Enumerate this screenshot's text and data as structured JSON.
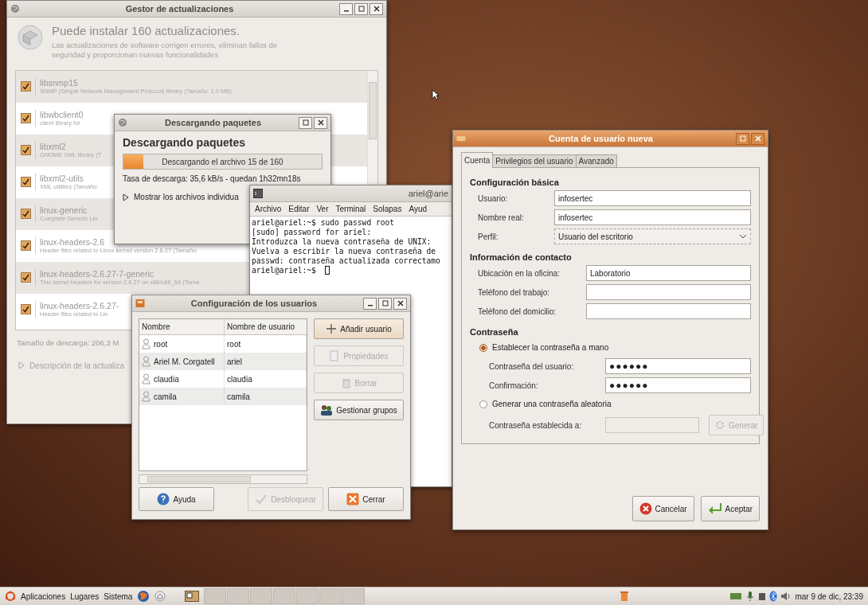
{
  "update_manager": {
    "title": "Gestor de actualizaciones",
    "heading": "Puede instalar 160 actualizaciones.",
    "description": "Las actualizaciones de software corrigen errores, eliminan fallos de seguridad y proporcionan nuevas funcionalidades",
    "packages": [
      {
        "name": "libsnmp15",
        "description": "SNMP (Simple Network Management Protocol) library (Tamaño: 1.0 MB)",
        "checked": true
      },
      {
        "name": "libwbclient0",
        "description": "client library for",
        "checked": true
      },
      {
        "name": "libxml2",
        "description": "GNOME XML library (T",
        "checked": true
      },
      {
        "name": "libxml2-utils",
        "description": "XML utilities (Tamaño:",
        "checked": true
      },
      {
        "name": "linux-generic",
        "description": "Complete Generic Lin",
        "checked": true
      },
      {
        "name": "linux-headers-2.6",
        "description": "Header files related to Linux kernel version 2.6.27 (Tamaño:",
        "checked": true
      },
      {
        "name": "linux-headers-2.6.27-7-generic",
        "description": "This kernel headers for version 2.6.27 on x86/x86_64 (Tama",
        "checked": true
      },
      {
        "name": "linux-headers-2.6.27-",
        "description": "Header files related to Lin",
        "checked": true
      }
    ],
    "download_size": "Tamaño de descarga: 206,3 M",
    "details_toggle": "Descripción de la actualiza"
  },
  "download_dialog": {
    "title": "Descargando paquetes",
    "heading": "Descargando paquetes",
    "progress": {
      "level": 0.1,
      "label": "Descargando el archivo 15 de 160"
    },
    "rate": "Tasa de descarga: 35,6 kB/s - quedan 1h32mn18s",
    "details_toggle": "Mostrar los archivos individua"
  },
  "terminal": {
    "title": "ariel@arie",
    "menu": [
      "Archivo",
      "Editar",
      "Ver",
      "Terminal",
      "Solapas",
      "Ayud"
    ],
    "lines": [
      "ariel@ariel:~$ sudo passwd root",
      "[sudo] password for ariel:",
      "Introduzca la nueva contraseña de UNIX:",
      "Vuelva a escribir la nueva contraseña de",
      "passwd: contraseña actualizada correctamo",
      "ariel@ariel:~$"
    ]
  },
  "users_dialog": {
    "title": "Configuración de los usuarios",
    "columns": [
      "Nombre",
      "Nombre de usuario"
    ],
    "users": [
      {
        "name": "root",
        "username": "root"
      },
      {
        "name": "Ariel M. Corgatell",
        "username": "ariel"
      },
      {
        "name": "claudia",
        "username": "claudia"
      },
      {
        "name": "camila",
        "username": "camila"
      }
    ],
    "side_buttons": [
      {
        "label": "Añadir usuario",
        "kind": "add",
        "disabled": false
      },
      {
        "label": "Propiedades",
        "kind": "properties",
        "disabled": true
      },
      {
        "label": "Borrar",
        "kind": "delete",
        "disabled": true
      },
      {
        "label": "Gestionar grupos",
        "kind": "groups",
        "disabled": false
      }
    ],
    "bottom_buttons": [
      {
        "label": "Ayuda",
        "kind": "help",
        "disabled": false
      },
      {
        "label": "Desbloquear",
        "kind": "unlock",
        "disabled": true
      },
      {
        "label": "Cerrar",
        "kind": "close",
        "disabled": false
      }
    ]
  },
  "account_dialog": {
    "title": "Cuenta de usuario nueva",
    "tabs": [
      {
        "label": "Cuenta",
        "selected": true
      },
      {
        "label": "Privilegios del usuario",
        "selected": false
      },
      {
        "label": "Avanzado",
        "selected": false
      }
    ],
    "basic": {
      "heading": "Configuración básica",
      "fields": [
        {
          "label": "Usuario:",
          "value": "infosertec",
          "kind": "text"
        },
        {
          "label": "Nombre real:",
          "value": "infosertec",
          "kind": "text"
        },
        {
          "label": "Perfil:",
          "value": "Usuario del escritorio",
          "kind": "select"
        }
      ]
    },
    "contact": {
      "heading": "Información de contacto",
      "fields": [
        {
          "label": "Ubicación en la oficina:",
          "value": "Laboratorio"
        },
        {
          "label": "Teléfono del trabajo:"
        },
        {
          "label": "Teléfono del domicilio:"
        }
      ]
    },
    "password": {
      "heading": "Contraseña",
      "manual": {
        "label": "Establecer la contraseña a mano",
        "selected": true
      },
      "fields": [
        {
          "label": "Contraseña del usuario:",
          "value": "●●●●●●"
        },
        {
          "label": "Confirmación:",
          "value": "●●●●●●"
        }
      ],
      "random": {
        "label": "Generar una contraseña aleatoria",
        "selected": false
      },
      "generated_label": "Contraseña establecida a:",
      "generate_button": {
        "label": "Generar",
        "disabled": true
      }
    },
    "buttons": [
      {
        "label": "Cancelar",
        "kind": "cancel"
      },
      {
        "label": "Aceptar",
        "kind": "accept"
      }
    ]
  },
  "taskbar": {
    "menus": [
      "Aplicaciones",
      "Lugares",
      "Sistema"
    ],
    "clock": "mar 9 de dic, 23:39"
  }
}
